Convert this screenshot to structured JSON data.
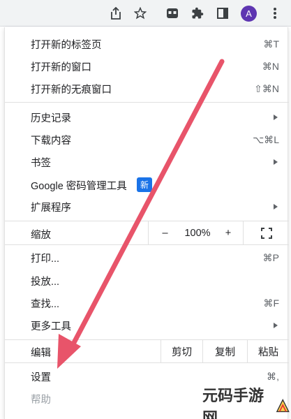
{
  "toolbar": {
    "icons": [
      "share-icon",
      "star-icon",
      "extension-tab-icon",
      "puzzle-icon",
      "sidepanel-icon",
      "more-vert-icon"
    ],
    "avatar_letter": "A",
    "avatar_color": "#5e35b1"
  },
  "menu": {
    "new_tab": {
      "label": "打开新的标签页",
      "shortcut": "⌘T"
    },
    "new_window": {
      "label": "打开新的窗口",
      "shortcut": "⌘N"
    },
    "new_incognito": {
      "label": "打开新的无痕窗口",
      "shortcut": "⇧⌘N"
    },
    "history": {
      "label": "历史记录"
    },
    "downloads": {
      "label": "下载内容",
      "shortcut": "⌥⌘L"
    },
    "bookmarks": {
      "label": "书签"
    },
    "password_manager": {
      "label": "Google 密码管理工具",
      "badge": "新"
    },
    "extensions": {
      "label": "扩展程序"
    },
    "zoom": {
      "label": "缩放",
      "minus": "–",
      "value": "100%",
      "plus": "+"
    },
    "print": {
      "label": "打印...",
      "shortcut": "⌘P"
    },
    "cast": {
      "label": "投放..."
    },
    "find": {
      "label": "查找...",
      "shortcut": "⌘F"
    },
    "more_tools": {
      "label": "更多工具"
    },
    "edit": {
      "label": "编辑",
      "cut": "剪切",
      "copy": "复制",
      "paste": "粘贴"
    },
    "settings": {
      "label": "设置",
      "shortcut": "⌘,"
    },
    "help": {
      "label": "帮助"
    }
  },
  "colors": {
    "accent": "#1a73e8",
    "annotation_arrow": "#e8546a"
  },
  "watermark": "元码手游网"
}
